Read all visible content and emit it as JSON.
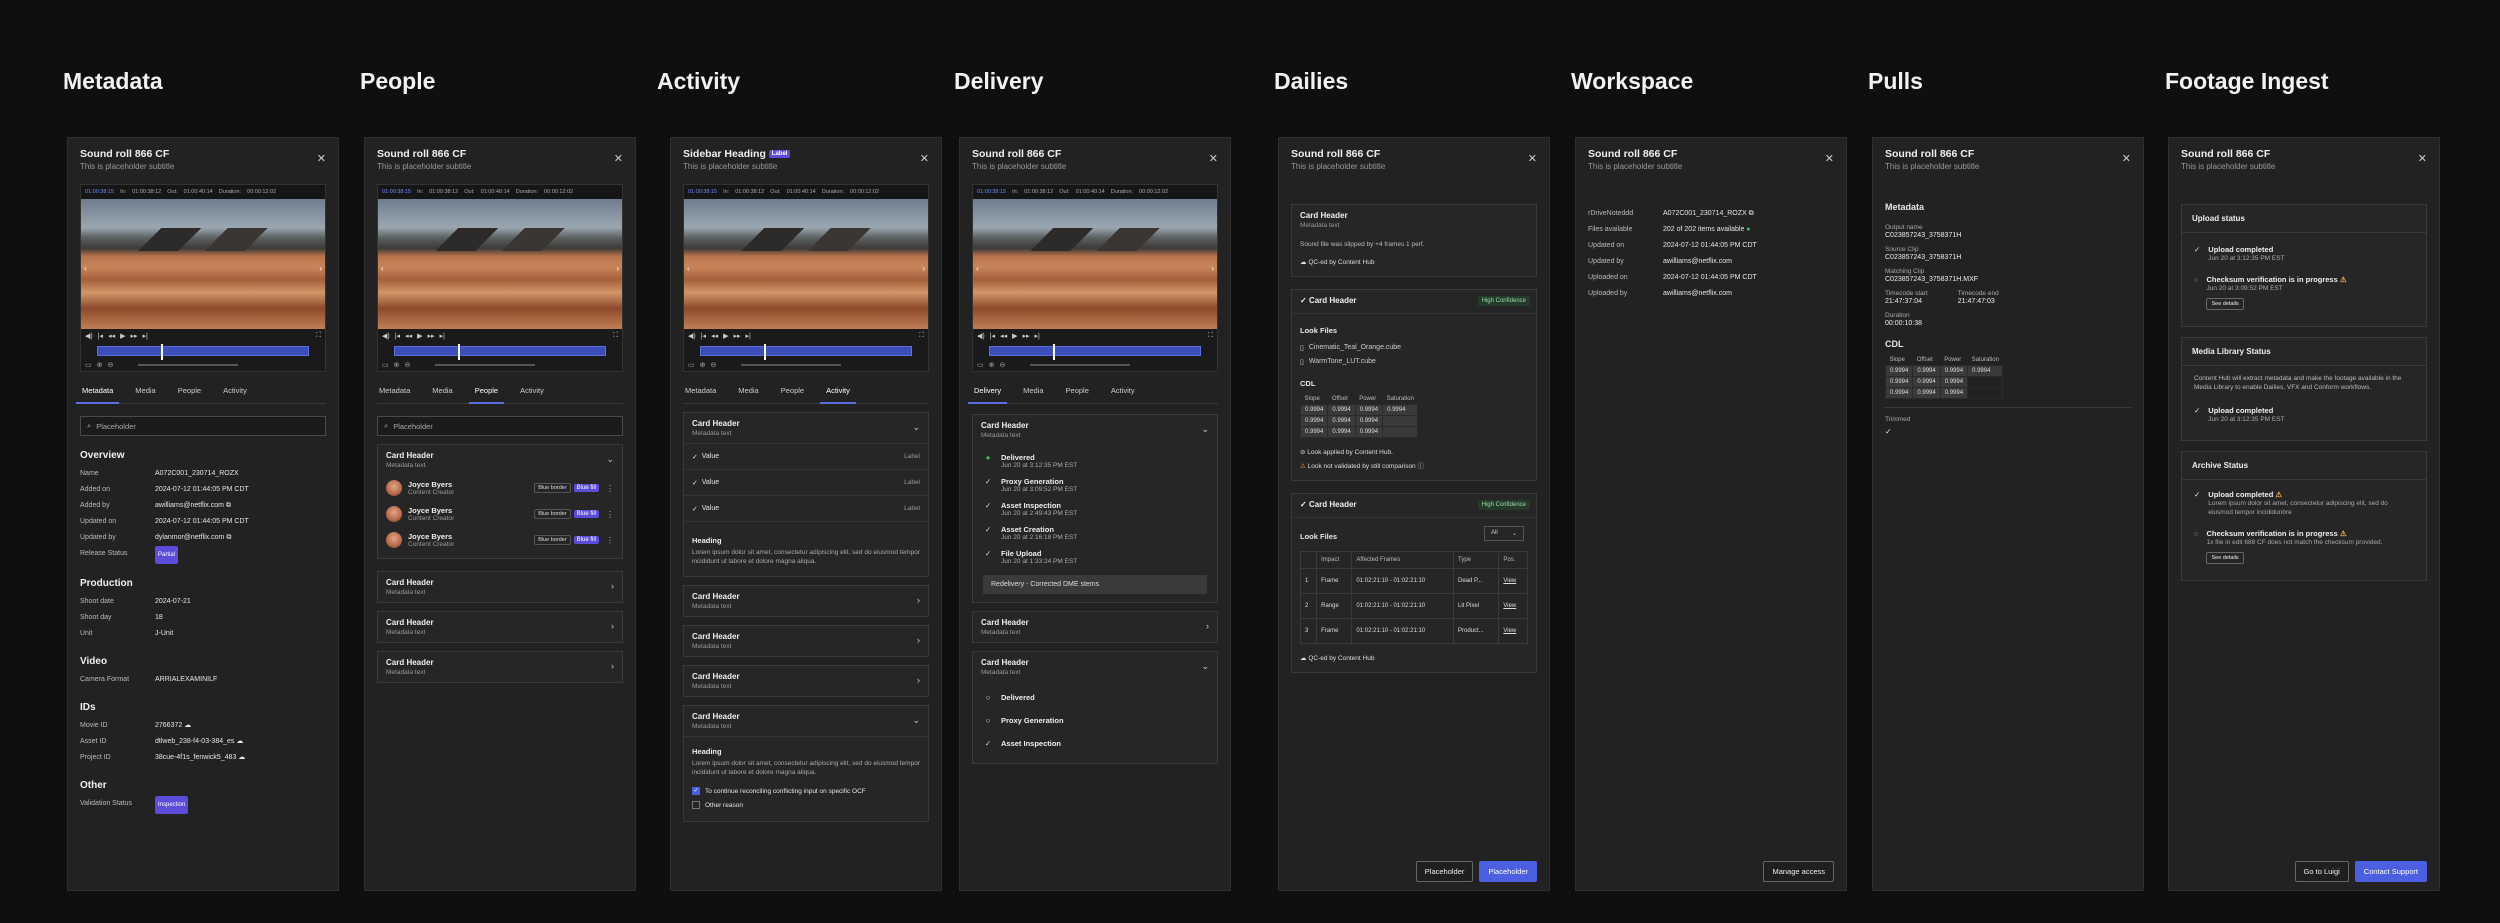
{
  "columns": [
    "Metadata",
    "People",
    "Activity",
    "Delivery",
    "Dailies",
    "Workspace",
    "Pulls",
    "Footage Ingest"
  ],
  "panel_title": "Sound roll 866 CF",
  "panel_subtitle": "This is placeholder subtitle",
  "sidebar_heading": "Sidebar Heading",
  "label_badge": "Label",
  "video": {
    "in_tc": "01:00:38:15",
    "in_label": "In:",
    "in_val": "01:00:38:12",
    "out_label": "Out:",
    "out_val": "01:00:40:14",
    "dur_label": "Duration:",
    "dur_val": "00:00:12:02"
  },
  "tabs4": [
    "Metadata",
    "Media",
    "People",
    "Activity"
  ],
  "tabs_delivery": [
    "Delivery",
    "Media",
    "People",
    "Activity"
  ],
  "search_placeholder": "Placeholder",
  "metadata": {
    "overview_title": "Overview",
    "overview": [
      [
        "Name",
        "A072C001_230714_ROZX"
      ],
      [
        "Added on",
        "2024-07-12 01:44:05 PM CDT"
      ],
      [
        "Added by",
        "awilliams@netflix.com"
      ],
      [
        "Updated on",
        "2024-07-12 01:44:05 PM CDT"
      ],
      [
        "Updated by",
        "dylanmor@netflix.com"
      ],
      [
        "Release Status",
        "Partial"
      ]
    ],
    "production_title": "Production",
    "production": [
      [
        "Shoot date",
        "2024-07-21"
      ],
      [
        "Shoot day",
        "18"
      ],
      [
        "Unit",
        "J-Unit"
      ]
    ],
    "video_title": "Video",
    "video": [
      [
        "Camera Format",
        "ARRIALEXAMINILF"
      ]
    ],
    "ids_title": "IDs",
    "ids": [
      [
        "Movie ID",
        "2766372"
      ],
      [
        "Asset ID",
        "dtlweb_238-f4-03-384_es"
      ],
      [
        "Project ID",
        "38cue-4f1s_fenwick5_483"
      ]
    ],
    "other_title": "Other",
    "other": [
      [
        "Validation Status",
        "Inspection"
      ]
    ]
  },
  "card": {
    "header": "Card Header",
    "meta": "Metadata text"
  },
  "people": [
    {
      "name": "Joyce Byers",
      "role": "Content Creator"
    },
    {
      "name": "Joyce Byers",
      "role": "Content Creator"
    },
    {
      "name": "Joyce Byers",
      "role": "Content Creator"
    }
  ],
  "people_badges": {
    "outline": "Blue border",
    "solid": "Blue fill"
  },
  "activity": {
    "value": "Value",
    "label": "Label",
    "heading": "Heading",
    "lorem": "Lorem ipsum dolor sit amet, consectetur adipiscing elit, sed do eiusmod tempor incididunt ut labore et dolore magna aliqua.",
    "checkbox1": "To continue reconciling conflicting input on specific OCF",
    "checkbox2": "Other reason"
  },
  "delivery": {
    "steps": [
      {
        "t": "Delivered",
        "d": "Jun 20 at 3:12:35 PM EST"
      },
      {
        "t": "Proxy Generation",
        "d": "Jun 20 at 3:09:52 PM EST"
      },
      {
        "t": "Asset Inspection",
        "d": "Jun 20 at 2:49:43 PM EST"
      },
      {
        "t": "Asset Creation",
        "d": "Jun 20 at 2:16:18 PM EST"
      },
      {
        "t": "File Upload",
        "d": "Jun 20 at 1:33:24 PM EST"
      }
    ],
    "redelivery": "Redelivery - Corrected DME stems",
    "steps2": [
      "Delivered",
      "Proxy Generation",
      "Asset Inspection"
    ]
  },
  "dailies": {
    "note": "Sound file was slipped by +4 frames 1 perf.",
    "qc": "QC-ed by Content Hub",
    "high_conf": "High Confidence",
    "look_files": "Look Files",
    "files": [
      "Cinematic_Teal_Orange.cube",
      "WarmTone_LUT.cube"
    ],
    "cdl": "CDL",
    "cdl_headers": [
      "Slope",
      "Offset",
      "Power",
      "Saturation"
    ],
    "cdl_rows": [
      [
        "0.9994",
        "0.9994",
        "0.9994",
        "0.9994"
      ],
      [
        "0.9994",
        "0.9994",
        "0.9994",
        ""
      ],
      [
        "0.9994",
        "0.9994",
        "0.9994",
        ""
      ]
    ],
    "applied": "Look applied by Content Hub.",
    "not_validated": "Look not validated by still comparison",
    "filter_all": "All",
    "lf_headers": [
      "Impact",
      "Affected Frames",
      "Type",
      "Pos."
    ],
    "lf_rows": [
      [
        "1",
        "Frame",
        "01:02:21:10 - 01:02:21:10",
        "Dead P...",
        "View"
      ],
      [
        "2",
        "Range",
        "01:02:21:10 - 01:02:21:10",
        "Lit Pixel",
        "View"
      ],
      [
        "3",
        "Frame",
        "01:02:21:10 - 01:02:21:10",
        "Product...",
        "View"
      ]
    ],
    "btn1": "Placeholder",
    "btn2": "Placeholder"
  },
  "workspace": {
    "rows": [
      [
        "rDriveNoteddd",
        "A072C001_230714_ROZX"
      ],
      [
        "Files available",
        "202 of 202 items available"
      ],
      [
        "Updated on",
        "2024-07-12 01:44:05 PM CDT"
      ],
      [
        "Updated by",
        "awilliams@netflix.com"
      ],
      [
        "Uploaded on",
        "2024-07-12 01:44:05 PM CDT"
      ],
      [
        "Uploaded by",
        "awilliams@netflix.com"
      ]
    ],
    "manage": "Manage access"
  },
  "pulls": {
    "title": "Metadata",
    "output_k": "Output name",
    "output_v": "C023857243_3758371H",
    "source_k": "Source Clip",
    "source_v": "C023857243_3758371H",
    "matching_k": "Matching Clip",
    "matching_v": "C023857243_3758371H.MXF",
    "tc_start_k": "Timecode start",
    "tc_start_v": "21:47:37:04",
    "tc_end_k": "Timecode end",
    "tc_end_v": "21:47:47:03",
    "duration_k": "Duration",
    "duration_v": "00:00:10:38",
    "cdl": "CDL",
    "trimmed": "Trimmed"
  },
  "ingest": {
    "upload_status": "Upload status",
    "upload_completed": "Upload completed",
    "checksum": "Checksum verification is in progress",
    "date1": "Jun 20 at 3:12:35 PM EST",
    "date2": "Jun 20 at 3:09:52 PM EST",
    "see_details": "See details",
    "mls": "Media Library Status",
    "mls_text": "Content Hub will extract metadata and make the footage available in the Media Library to enable Dailies, VFX and Conform workflows.",
    "archive": "Archive Status",
    "archive_text": "Lorem ipsum dolor sit amet, consectetur adipiscing elit, sed do eiusmod tempor incididunbre",
    "archive_err": "1x file in edit 688 CF does not match the checksum provided.",
    "btn1": "Go to Luigi",
    "btn2": "Contact Support"
  }
}
